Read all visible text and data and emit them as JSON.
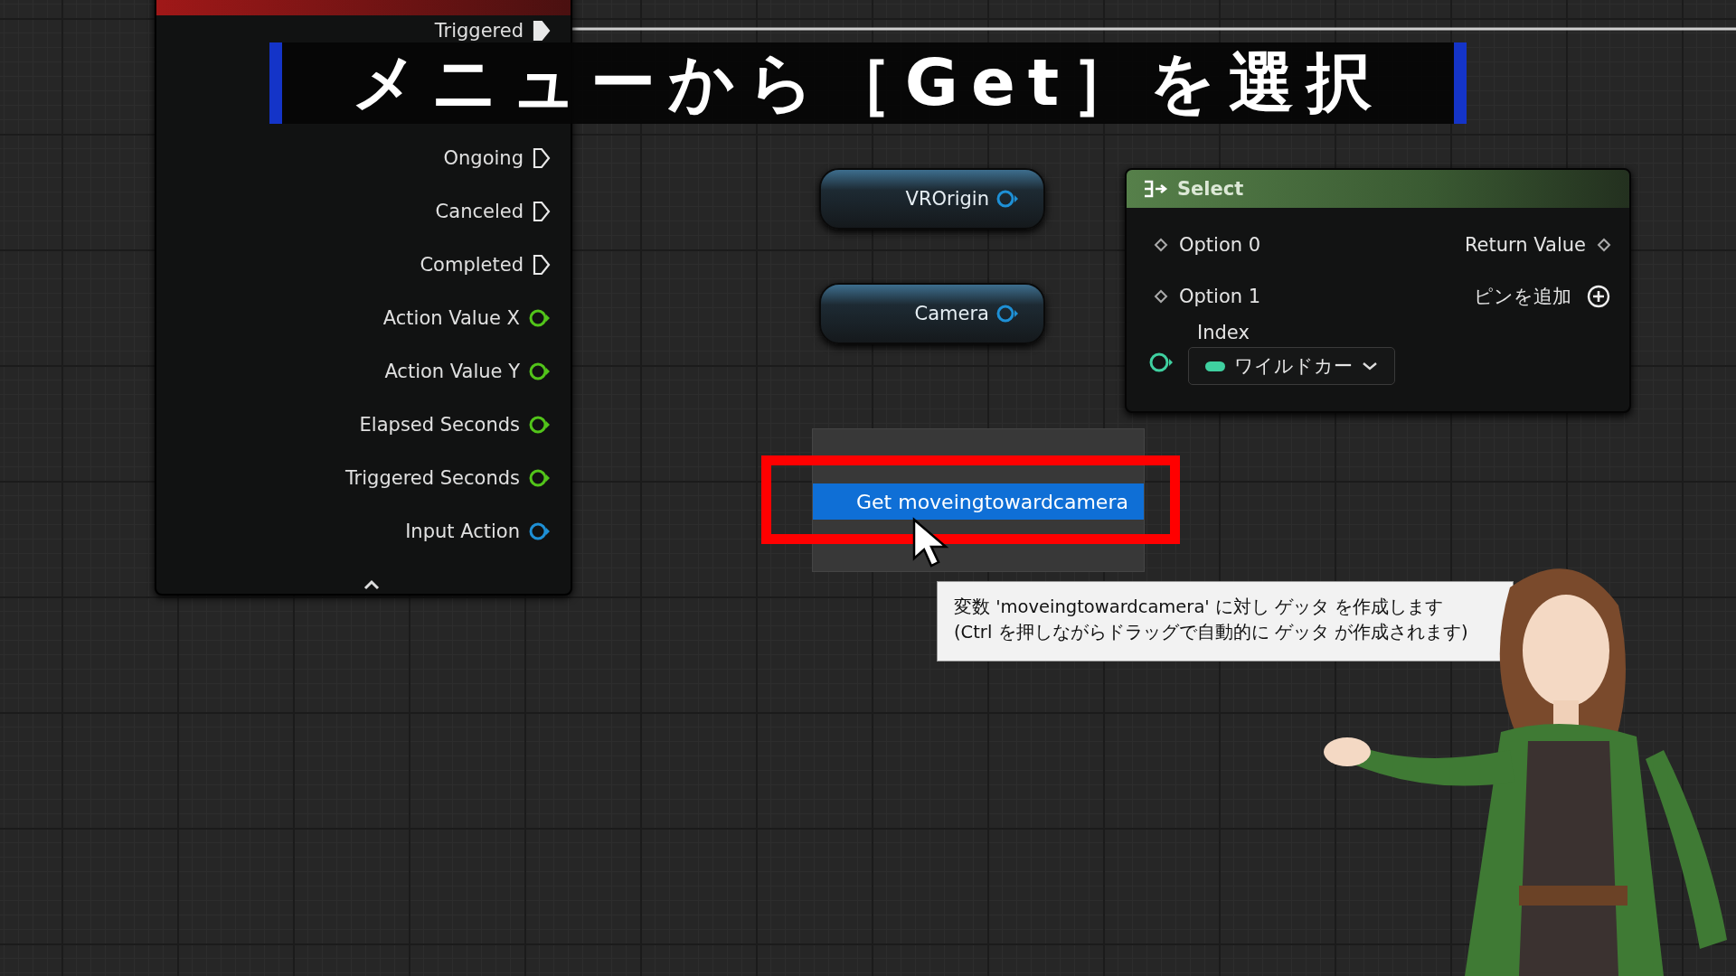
{
  "caption": {
    "text": "メニューから［Get］を選択"
  },
  "input_node": {
    "pins": [
      {
        "label": "Triggered",
        "kind": "exec",
        "connected": true
      },
      {
        "label": "Ongoing",
        "kind": "exec",
        "connected": false
      },
      {
        "label": "Canceled",
        "kind": "exec",
        "connected": false
      },
      {
        "label": "Completed",
        "kind": "exec",
        "connected": false
      },
      {
        "label": "Action Value X",
        "kind": "data",
        "color": "#52c41a"
      },
      {
        "label": "Action Value Y",
        "kind": "data",
        "color": "#52c41a"
      },
      {
        "label": "Elapsed Seconds",
        "kind": "data",
        "color": "#52c41a"
      },
      {
        "label": "Triggered Seconds",
        "kind": "data",
        "color": "#52c41a"
      },
      {
        "label": "Input Action",
        "kind": "data",
        "color": "#1e90d6"
      }
    ]
  },
  "variable_nodes": [
    {
      "label": "VROrigin"
    },
    {
      "label": "Camera"
    }
  ],
  "select_node": {
    "title": "Select",
    "inputs": [
      "Option 0",
      "Option 1"
    ],
    "output": "Return Value",
    "add_pin": "ピンを追加",
    "index": {
      "label": "Index",
      "value": "ワイルドカー"
    }
  },
  "context_menu": {
    "items": [
      {
        "label": "Get moveingtowardcamera",
        "selected": true
      }
    ]
  },
  "tooltip": {
    "lines": [
      "変数 'moveingtowardcamera' に対し ゲッタ を作成します",
      "(Ctrl を押しながらドラッグで自動的に ゲッタ が作成されます)"
    ]
  }
}
